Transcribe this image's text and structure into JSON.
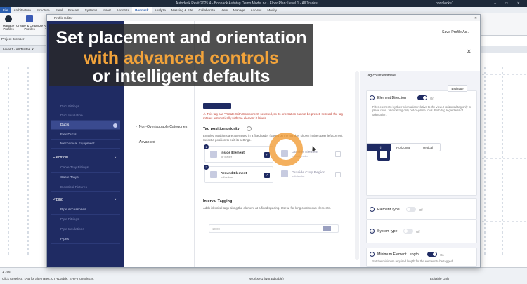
{
  "titlebar": {
    "title": "Autodesk Revit 2025.4 - Bonnack Autotag Demo Model.rvt - Floor Plan: Level 1 - All Trades",
    "user": "bonnlocke1",
    "winbtns": "– □ ✕"
  },
  "ribbon_tabs": [
    "File",
    "Architecture",
    "Structure",
    "Steel",
    "Precast",
    "Systems",
    "Insert",
    "Annotate",
    "Bonnack",
    "Analyze",
    "Massing & Site",
    "Collaborate",
    "View",
    "Manage",
    "Add-Ins",
    "Modify"
  ],
  "ribbon_buttons": [
    {
      "label": "Manage Profiles"
    },
    {
      "label": "Create & Organize Profiles"
    },
    {
      "label": "Run All Tags"
    }
  ],
  "project_bar": "Project Browser",
  "view_tab": "Level 1 - All Trades  ✕",
  "dialog": {
    "title": "Profile Editor",
    "close": "✕",
    "save_as": "Save Profile As...",
    "close_big": "✕"
  },
  "sidebar": {
    "sections": [
      {
        "label": "Electrical",
        "chev": "⌄"
      },
      {
        "label": "Piping",
        "chev": "⌄"
      }
    ],
    "ducts_items": [
      "Duct Fittings",
      "Duct Insulation",
      "Ducts",
      "Flex Ducts",
      "Mechanical Equipment"
    ],
    "electrical_items": [
      "Cable Tray Fittings",
      "Cable Trays",
      "Electrical Fixtures"
    ],
    "piping_items": [
      "Pipe Accessories",
      "Pipe Fittings",
      "Pipe Insulations",
      "Pipes"
    ]
  },
  "column2": {
    "items": [
      {
        "label": "Non-Overlappable Categories",
        "chev": "›"
      },
      {
        "label": "Advanced",
        "chev": "›"
      }
    ]
  },
  "main": {
    "warning": "⚠ This tag has \"Rotate With Component\" selected, so its orientation cannot be preset. Instead, the tag rotates automatically with the element it labels.",
    "tag_position": {
      "title": "Tag position priority",
      "desc": "Enabled positions are attempted in a fixed order (based on the number shown in the upper left corner). Select a position to edit its settings.",
      "cards": [
        {
          "num": "1",
          "title": "Inside Element",
          "desc": "for leader",
          "checked": "✓"
        },
        {
          "num": "",
          "title": "Outside Element",
          "desc": "without leader",
          "checked": ""
        },
        {
          "num": "2",
          "title": "Around Element",
          "desc": "with elbow",
          "checked": "✓"
        },
        {
          "num": "",
          "title": "Outside Crop Region",
          "desc": "with leader",
          "checked": ""
        }
      ]
    },
    "interval": {
      "title": "Interval Tagging",
      "desc": "Adds identical tags along the element at a fixed spacing. Useful for long continuous elements.",
      "toggle_label": "Off",
      "input_value": "10.00"
    }
  },
  "right": {
    "count_title": "Tag count estimate",
    "estimate_btn": "Estimate",
    "element_direction": {
      "title": "Element Direction",
      "toggle_label": "On",
      "desc": "Filter elements by their orientation relative to the view. Horizontal tag only in-plane rows. Vertical tag only out-of-plane rows. Both tag regardless of orientation.",
      "options": [
        "Both",
        "Horizontal",
        "Vertical"
      ],
      "selected": "Both"
    },
    "element_type": {
      "title": "Element Type",
      "toggle_label": "Off"
    },
    "system_type": {
      "title": "System type",
      "toggle_label": "Off"
    },
    "min_length": {
      "title": "Minimum Element Length",
      "toggle_label": "On",
      "desc": "Set the minimum required length for the element to be tagged."
    }
  },
  "statusbar": {
    "scale": "1 : 96",
    "hint": "Click to select, TAB for alternates, CTRL adds, SHIFT unselects.",
    "workset": "Workset1 (Not Editable)",
    "editable": "Editable Only"
  },
  "banner": {
    "line1": "Set placement and orientation",
    "line2": "with advanced controls",
    "line3": "or intelligent defaults"
  },
  "colors": {
    "accent": "#1f2b63",
    "banner_highlight": "#f2a33a",
    "warning": "#c0392b"
  }
}
